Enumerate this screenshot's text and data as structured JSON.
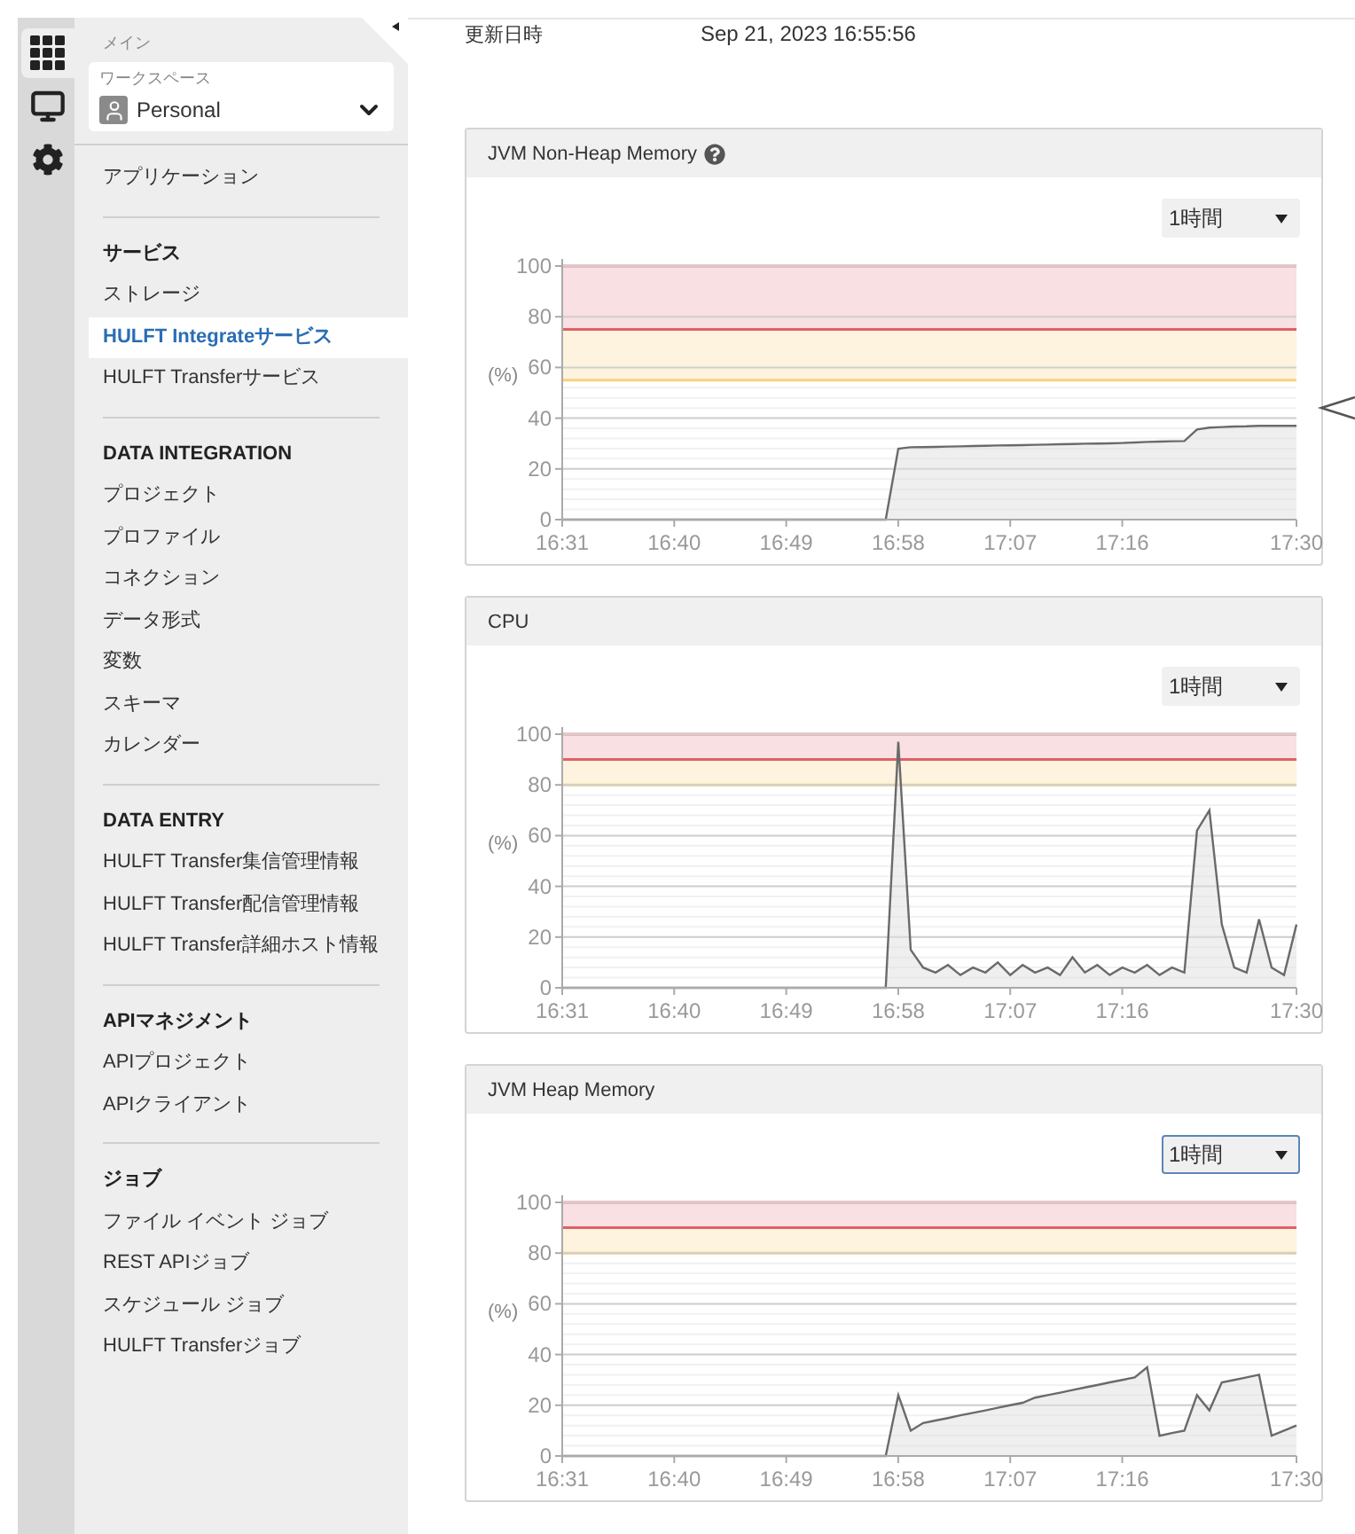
{
  "rail": [
    {
      "kind": "grid",
      "selected": true
    },
    {
      "kind": "monitor",
      "selected": false
    },
    {
      "kind": "gear",
      "selected": false
    }
  ],
  "sidebar": {
    "section_label": "メイン",
    "workspace": {
      "label": "ワークスペース",
      "value": "Personal"
    },
    "groups": [
      {
        "items": [
          {
            "label": "アプリケーション",
            "selected": false
          }
        ]
      },
      {
        "heading": "サービス",
        "items": [
          {
            "label": "ストレージ",
            "selected": false
          },
          {
            "label": "HULFT Integrateサービス",
            "selected": true
          },
          {
            "label": "HULFT Transferサービス",
            "selected": false
          }
        ]
      },
      {
        "heading": "DATA INTEGRATION",
        "items": [
          {
            "label": "プロジェクト",
            "selected": false
          },
          {
            "label": "プロファイル",
            "selected": false
          },
          {
            "label": "コネクション",
            "selected": false
          },
          {
            "label": "データ形式",
            "selected": false
          },
          {
            "label": "変数",
            "selected": false
          },
          {
            "label": "スキーマ",
            "selected": false
          },
          {
            "label": "カレンダー",
            "selected": false
          }
        ]
      },
      {
        "heading": "DATA ENTRY",
        "items": [
          {
            "label": "HULFT Transfer集信管理情報",
            "selected": false
          },
          {
            "label": "HULFT Transfer配信管理情報",
            "selected": false
          },
          {
            "label": "HULFT Transfer詳細ホスト情報",
            "selected": false
          }
        ]
      },
      {
        "heading": "APIマネジメント",
        "items": [
          {
            "label": "APIプロジェクト",
            "selected": false
          },
          {
            "label": "APIクライアント",
            "selected": false
          }
        ]
      },
      {
        "heading": "ジョブ",
        "items": [
          {
            "label": "ファイル イベント ジョブ",
            "selected": false
          },
          {
            "label": "REST APIジョブ",
            "selected": false
          },
          {
            "label": "スケジュール ジョブ",
            "selected": false
          },
          {
            "label": "HULFT Transferジョブ",
            "selected": false
          }
        ]
      }
    ]
  },
  "updated": {
    "label": "更新日時",
    "value": "Sep 21, 2023 16:55:56"
  },
  "panels": [
    {
      "title": "JVM Non-Heap Memory",
      "help": true,
      "range": {
        "value": "1時間",
        "focused": false
      },
      "unit_label": "(%)",
      "chart_data": {
        "type": "area",
        "categories": [
          "16:31",
          null,
          null,
          null,
          null,
          null,
          null,
          null,
          null,
          "16:40",
          null,
          null,
          null,
          null,
          null,
          null,
          null,
          null,
          "16:49",
          null,
          null,
          null,
          null,
          null,
          null,
          null,
          null,
          "16:58",
          null,
          null,
          null,
          null,
          null,
          null,
          null,
          null,
          "17:07",
          null,
          null,
          null,
          null,
          null,
          null,
          null,
          null,
          "17:16",
          null,
          null,
          null,
          null,
          null,
          null,
          null,
          null,
          null,
          null,
          null,
          null,
          null,
          "17:30"
        ],
        "ylim": [
          0,
          100
        ],
        "grid": true,
        "series": [
          {
            "values": [
              0,
              0,
              0,
              0,
              0,
              0,
              0,
              0,
              0,
              0,
              0,
              0,
              0,
              0,
              0,
              0,
              0,
              0,
              0,
              0,
              0,
              0,
              0,
              0,
              0,
              0,
              0,
              28,
              28.5,
              28.6,
              28.7,
              28.8,
              28.9,
              29,
              29.1,
              29.2,
              29.3,
              29.4,
              29.5,
              29.6,
              29.7,
              29.8,
              29.9,
              30,
              30.1,
              30.2,
              30.4,
              30.6,
              30.8,
              30.9,
              31,
              35.5,
              36.3,
              36.5,
              36.7,
              36.8,
              37,
              37,
              37,
              37
            ]
          }
        ],
        "yticks": [
          0,
          20,
          40,
          60,
          80,
          100
        ],
        "bands": [
          {
            "axis": "y",
            "from": 55,
            "to": 75,
            "color": "#fdf3de"
          },
          {
            "axis": "y",
            "from": 75,
            "to": 100,
            "color": "#f9e0e2"
          }
        ],
        "ref_lines": [
          {
            "axis": "y",
            "value": 55,
            "color": "#f8d27e"
          },
          {
            "axis": "y",
            "value": 75,
            "color": "#e06068"
          },
          {
            "axis": "y",
            "value": 100,
            "color": "#ea8a90"
          }
        ]
      }
    },
    {
      "title": "CPU",
      "help": false,
      "range": {
        "value": "1時間",
        "focused": false
      },
      "unit_label": "(%)",
      "chart_data": {
        "type": "area",
        "categories": [
          "16:31",
          null,
          null,
          null,
          null,
          null,
          null,
          null,
          null,
          "16:40",
          null,
          null,
          null,
          null,
          null,
          null,
          null,
          null,
          "16:49",
          null,
          null,
          null,
          null,
          null,
          null,
          null,
          null,
          "16:58",
          null,
          null,
          null,
          null,
          null,
          null,
          null,
          null,
          "17:07",
          null,
          null,
          null,
          null,
          null,
          null,
          null,
          null,
          "17:16",
          null,
          null,
          null,
          null,
          null,
          null,
          null,
          null,
          null,
          null,
          null,
          null,
          null,
          "17:30"
        ],
        "ylim": [
          0,
          100
        ],
        "grid": true,
        "series": [
          {
            "values": [
              0,
              0,
              0,
              0,
              0,
              0,
              0,
              0,
              0,
              0,
              0,
              0,
              0,
              0,
              0,
              0,
              0,
              0,
              0,
              0,
              0,
              0,
              0,
              0,
              0,
              0,
              0,
              97,
              15,
              8,
              6,
              9,
              5,
              8,
              6,
              10,
              5,
              9,
              6,
              8,
              5,
              12,
              6,
              9,
              5,
              8,
              6,
              9,
              5,
              8,
              6,
              62,
              70,
              25,
              8,
              6,
              27,
              8,
              5,
              25
            ]
          }
        ],
        "yticks": [
          0,
          20,
          40,
          60,
          80,
          100
        ],
        "bands": [
          {
            "axis": "y",
            "from": 80,
            "to": 90,
            "color": "#fdf3de"
          },
          {
            "axis": "y",
            "from": 90,
            "to": 100,
            "color": "#f9e0e2"
          }
        ],
        "ref_lines": [
          {
            "axis": "y",
            "value": 80,
            "color": "#f8d27e"
          },
          {
            "axis": "y",
            "value": 90,
            "color": "#e06068"
          },
          {
            "axis": "y",
            "value": 100,
            "color": "#ea8a90"
          }
        ]
      }
    },
    {
      "title": "JVM Heap Memory",
      "help": false,
      "range": {
        "value": "1時間",
        "focused": true
      },
      "unit_label": "(%)",
      "chart_data": {
        "type": "area",
        "categories": [
          "16:31",
          null,
          null,
          null,
          null,
          null,
          null,
          null,
          null,
          "16:40",
          null,
          null,
          null,
          null,
          null,
          null,
          null,
          null,
          "16:49",
          null,
          null,
          null,
          null,
          null,
          null,
          null,
          null,
          "16:58",
          null,
          null,
          null,
          null,
          null,
          null,
          null,
          null,
          "17:07",
          null,
          null,
          null,
          null,
          null,
          null,
          null,
          null,
          "17:16",
          null,
          null,
          null,
          null,
          null,
          null,
          null,
          null,
          null,
          null,
          null,
          null,
          null,
          "17:30"
        ],
        "ylim": [
          0,
          100
        ],
        "grid": true,
        "series": [
          {
            "values": [
              0,
              0,
              0,
              0,
              0,
              0,
              0,
              0,
              0,
              0,
              0,
              0,
              0,
              0,
              0,
              0,
              0,
              0,
              0,
              0,
              0,
              0,
              0,
              0,
              0,
              0,
              0,
              24,
              10,
              13,
              14,
              15,
              16,
              17,
              18,
              19,
              20,
              21,
              23,
              24,
              25,
              26,
              27,
              28,
              29,
              30,
              31,
              35,
              8,
              9,
              10,
              24,
              18,
              29,
              30,
              31,
              32,
              8,
              10,
              12
            ]
          }
        ],
        "yticks": [
          0,
          20,
          40,
          60,
          80,
          100
        ],
        "bands": [
          {
            "axis": "y",
            "from": 80,
            "to": 90,
            "color": "#fdf3de"
          },
          {
            "axis": "y",
            "from": 90,
            "to": 100,
            "color": "#f9e0e2"
          }
        ],
        "ref_lines": [
          {
            "axis": "y",
            "value": 80,
            "color": "#f8d27e"
          },
          {
            "axis": "y",
            "value": 90,
            "color": "#e06068"
          },
          {
            "axis": "y",
            "value": 100,
            "color": "#ea8a90"
          }
        ]
      }
    }
  ]
}
